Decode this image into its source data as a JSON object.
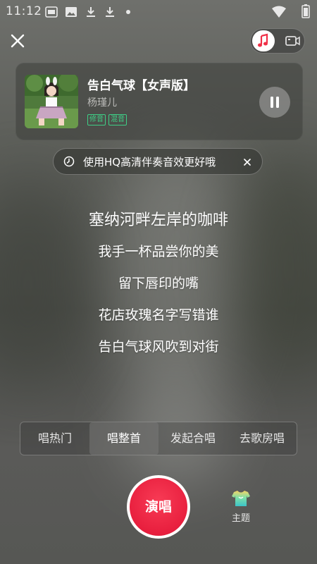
{
  "statusbar": {
    "time": "11:12",
    "icons": [
      "app-badge-icon",
      "image-icon",
      "download-icon",
      "download-icon",
      "dot-icon",
      "wifi-icon",
      "battery-icon"
    ]
  },
  "header": {
    "close_icon": "close-icon",
    "mode_toggle": {
      "audio_icon": "music-note-icon",
      "video_icon": "video-icon",
      "selected": "audio"
    }
  },
  "song": {
    "title": "告白气球【女声版】",
    "artist": "杨瑾儿",
    "tags": [
      "修音",
      "混音"
    ],
    "state_icon": "pause-icon"
  },
  "hint": {
    "icon": "hq-icon",
    "text": "使用HQ高清伴奏音效更好哦",
    "close_icon": "close-icon"
  },
  "lyrics": [
    "塞纳河畔左岸的咖啡",
    "我手一杯品尝你的美",
    "留下唇印的嘴",
    "花店玫瑰名字写错谁",
    "告白气球风吹到对街"
  ],
  "tabs": [
    {
      "label": "唱热门",
      "active": false
    },
    {
      "label": "唱整首",
      "active": true
    },
    {
      "label": "发起合唱",
      "active": false
    },
    {
      "label": "去歌房唱",
      "active": false
    }
  ],
  "sing_button": {
    "label": "演唱"
  },
  "theme": {
    "icon": "shirt-icon",
    "label": "主题"
  },
  "colors": {
    "accent_red": "#e81f3e",
    "tag_green": "#3ecf86",
    "toggle_red": "#f03047"
  }
}
